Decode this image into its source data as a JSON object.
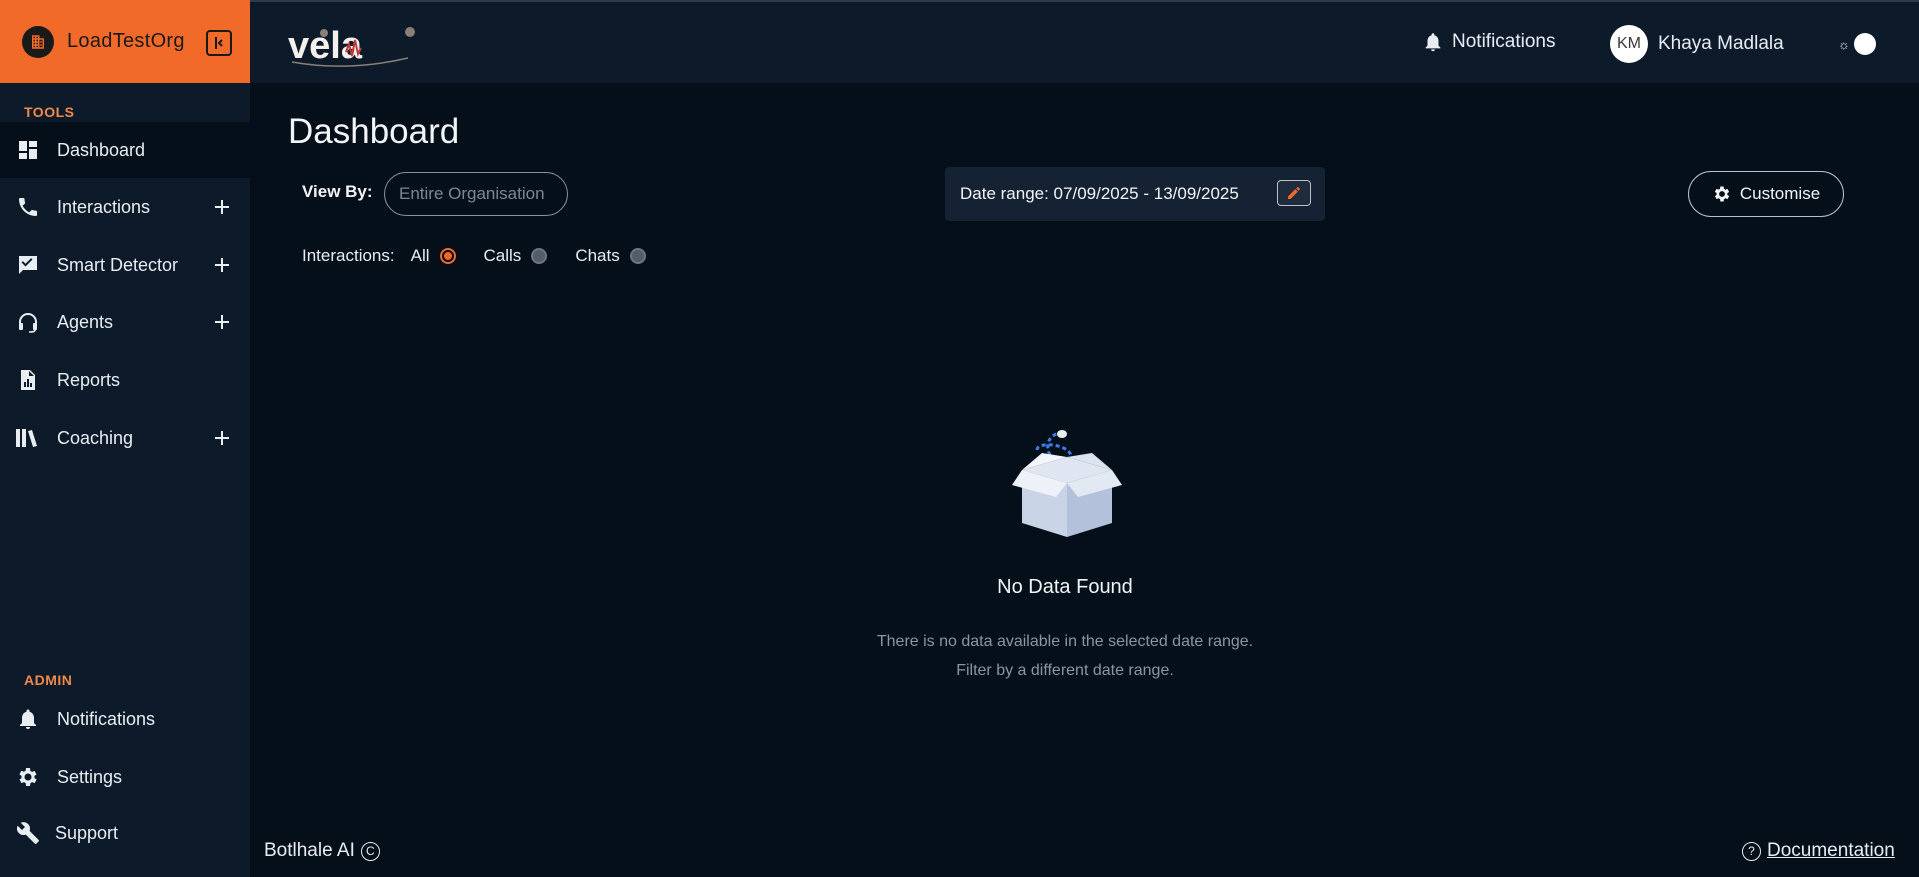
{
  "org": {
    "name": "LoadTestOrg"
  },
  "logo": {
    "text": "vela"
  },
  "sidebar": {
    "tools_label": "TOOLS",
    "admin_label": "ADMIN",
    "tools": [
      {
        "label": "Dashboard",
        "icon": "dashboard-icon",
        "expandable": false,
        "active": true
      },
      {
        "label": "Interactions",
        "icon": "phone-icon",
        "expandable": true
      },
      {
        "label": "Smart Detector",
        "icon": "check-chart-icon",
        "expandable": true
      },
      {
        "label": "Agents",
        "icon": "headset-icon",
        "expandable": true
      },
      {
        "label": "Reports",
        "icon": "report-icon",
        "expandable": false
      },
      {
        "label": "Coaching",
        "icon": "books-icon",
        "expandable": true
      }
    ],
    "admin": [
      {
        "label": "Notifications",
        "icon": "bell-icon"
      },
      {
        "label": "Settings",
        "icon": "gear-icon"
      },
      {
        "label": "Support",
        "icon": "wrench-icon"
      }
    ]
  },
  "topbar": {
    "notifications_label": "Notifications",
    "user_initials": "KM",
    "user_name": "Khaya Madlala",
    "theme_icon": "☼"
  },
  "main": {
    "title": "Dashboard",
    "view_by_label": "View By:",
    "view_by_placeholder": "Entire Organisation",
    "date_range_label": "Date range: 07/09/2025 - 13/09/2025",
    "customise_label": "Customise",
    "interactions_label": "Interactions:",
    "filter_options": [
      {
        "label": "All",
        "checked": true
      },
      {
        "label": "Calls",
        "checked": false
      },
      {
        "label": "Chats",
        "checked": false
      }
    ],
    "empty_title": "No Data Found",
    "empty_description": "There is no data available in the selected date range. Filter by a different date range."
  },
  "footer": {
    "brand": "Botlhale AI",
    "copyright_symbol": "C",
    "help_symbol": "?",
    "documentation_label": "Documentation"
  },
  "colors": {
    "accent": "#f26a2a",
    "sidebar_bg": "#0c1a2a",
    "main_bg": "#040f1a"
  }
}
